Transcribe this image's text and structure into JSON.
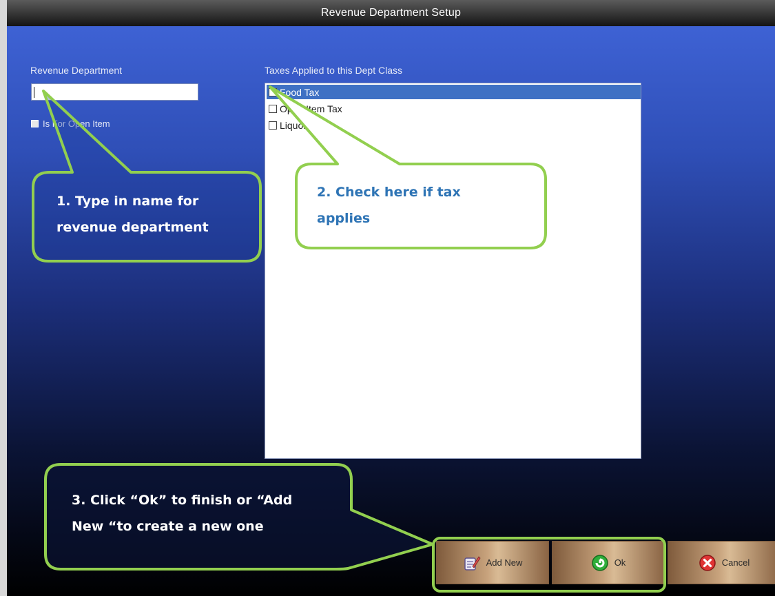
{
  "window": {
    "title": "Revenue Department Setup"
  },
  "form": {
    "revenue_department_label": "Revenue Department",
    "revenue_department_value": "",
    "open_item_label": "Is For Open Item",
    "taxes_label": "Taxes Applied to this Dept Class",
    "taxes": [
      {
        "label": "Food Tax",
        "checked": false,
        "selected": true
      },
      {
        "label": "Open Item Tax",
        "checked": false,
        "selected": false
      },
      {
        "label": "Liquor Tax",
        "checked": false,
        "selected": false
      }
    ]
  },
  "buttons": {
    "add_new": "Add New",
    "ok": "Ok",
    "cancel": "Cancel"
  },
  "callouts": {
    "step1_line1": "1. Type in name for",
    "step1_line2": "revenue department",
    "step2_line1": "2. Check here if tax",
    "step2_line2": "applies",
    "step3_line1": "3. Click “Ok” to finish or “Add",
    "step3_line2": "New “to create a new one"
  },
  "colors": {
    "callout_border": "#92cf4f",
    "callout_text_blue": "#2e74b5",
    "selection": "#3f71c4"
  }
}
